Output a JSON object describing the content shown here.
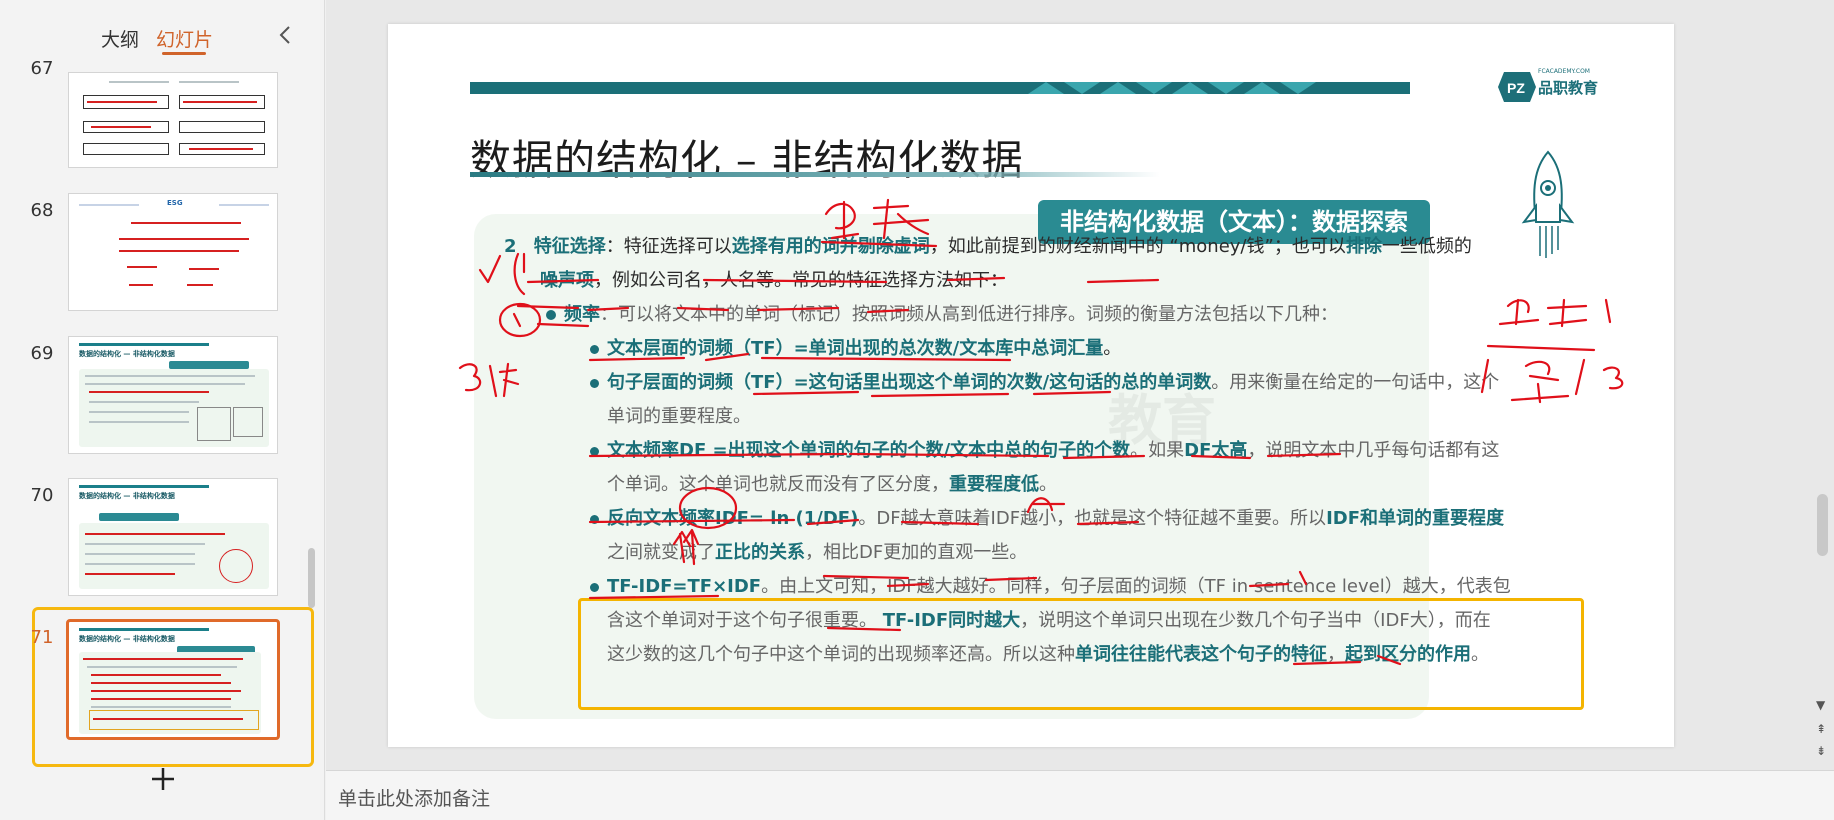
{
  "panel": {
    "tabs": [
      {
        "label": "大纲"
      },
      {
        "label": "幻灯片"
      }
    ],
    "collapse_icon": "chevron-left-icon",
    "add_icon": "plus-icon"
  },
  "thumbnails": [
    {
      "number": "67"
    },
    {
      "number": "68",
      "heading": "ESG"
    },
    {
      "number": "69",
      "title": "数据的结构化 — 非结构化数据"
    },
    {
      "number": "70",
      "title": "数据的结构化 — 非结构化数据"
    },
    {
      "number": "71",
      "title": "数据的结构化 — 非结构化数据"
    }
  ],
  "notes": {
    "placeholder": "单击此处添加备注"
  },
  "slide": {
    "title": "数据的结构化 – 非结构化数据",
    "logo_text": "品职教育",
    "logo_url": "FCACADEMY.COM",
    "section": "非结构化数据（文本）：数据探索",
    "watermark": "教育",
    "p1": {
      "num": "2",
      "term": "特征选择",
      "t1": "：特征选择可以",
      "b1": "选择有用的词并剔除虚词",
      "t2": "，如此前提到的财经新闻中的 “money/钱”；也可以",
      "b2": "排除",
      "t3": "一些低频的",
      "b3": "噪声项",
      "t4": "，例如公司名，人名等。常见的特征选择方法如下："
    },
    "p2": {
      "term": "频率",
      "text": "：可以将文本中的单词（标记）按照词频从高到低进行排序。词频的衡量方法包括以下几种："
    },
    "b_tf_doc": {
      "bold": "文本层面的词频（TF）=单词出现的总次数/文本库中总词汇量",
      "text": "。"
    },
    "b_tf_sent": {
      "bold": "句子层面的词频（TF）=这句话里出现这个单词的次数/这句话的总的单词数",
      "text1": "。用来衡量在给定的一句话中，这个",
      "text2": "单词的重要程度。"
    },
    "b_df": {
      "bold": "文本频率DF =出现这个单词的句子的个数/文本中总的句子的个数",
      "t1": "。如果",
      "b2": "DF太高",
      "t2": "，说明文本中几乎每句话都有这",
      "t3": "个单词。这个单词也就反而没有了区分度，",
      "b3": "重要程度低",
      "t4": "。"
    },
    "b_idf": {
      "bold": "反向文本频率IDF= ln (1/DF)",
      "t1": "。DF越大意味着IDF越小，也就是这个特征越不重要。所以",
      "b2": "IDF和单词的重要程度",
      "t2": "之间就变成了",
      "b3": "正比的关系",
      "t3": "，相比DF更加的直观一些。"
    },
    "b_tfidf": {
      "bold": "TF-IDF=TF×IDF",
      "t1": "。由上文可知，IDF越大越好。同样，句子层面的词频（TF in sentence level）越大，代表包",
      "t2": "含这个单词对于这个句子很重要。",
      "b2": "TF-IDF同时越大",
      "t3": "，说明这个单词只出现在少数几个句子当中（IDF大），而在",
      "t4": "这少数的这几个句子中这个单词的出现频率还高。所以这种",
      "b4": "单词往往能代表这个句子的特征",
      "t5": "，",
      "b5": "起到区分的作用",
      "t6": "。"
    }
  },
  "colors": {
    "accent_teal": "#1b6f78",
    "tab_active": "#d0632a",
    "highlight": "#f4b400",
    "ink_red": "#e0101a"
  }
}
